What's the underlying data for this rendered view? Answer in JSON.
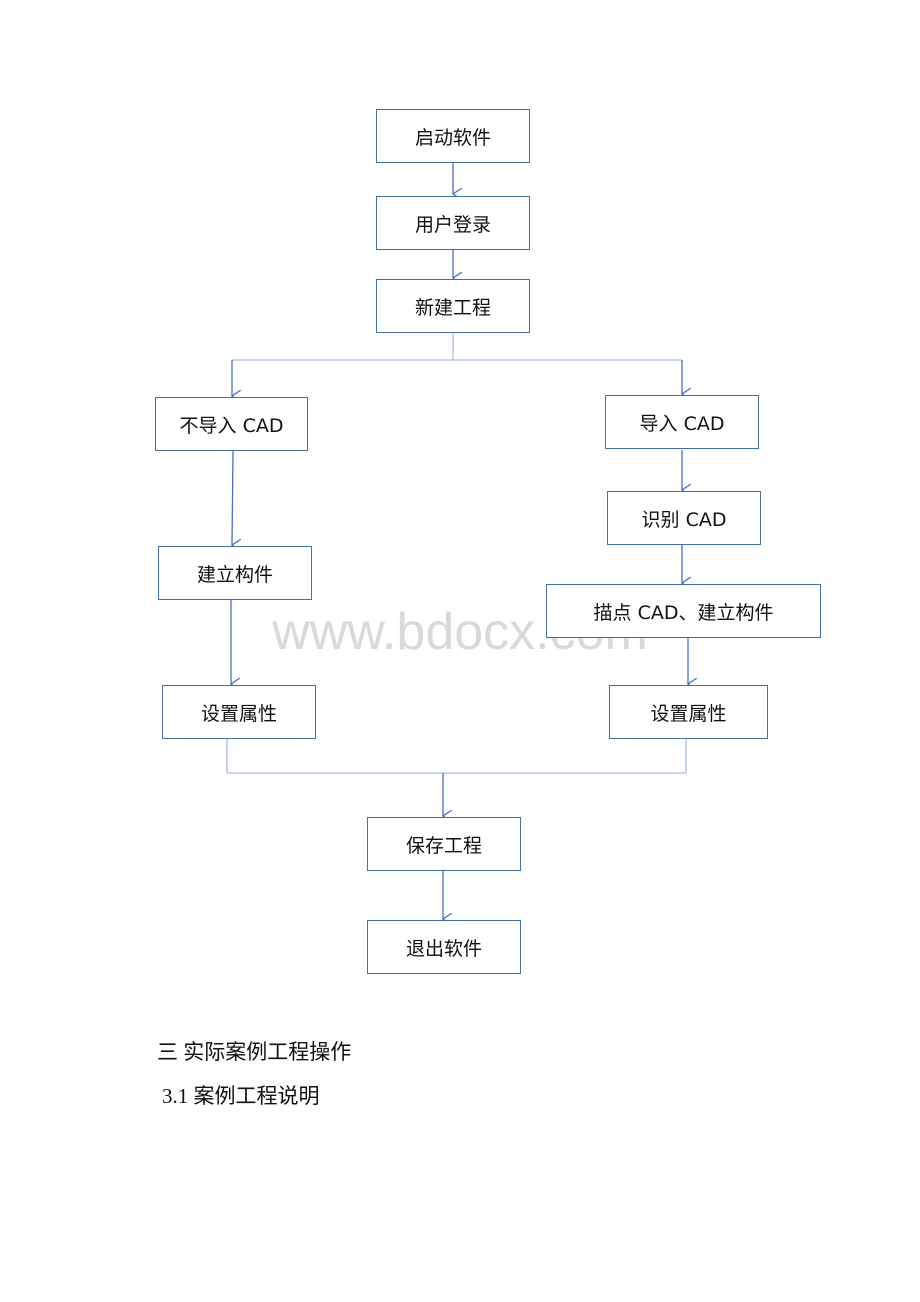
{
  "flowchart": {
    "nodes": [
      "启动软件",
      "用户登录",
      "新建工程",
      "不导入 CAD",
      "导入 CAD",
      "识别 CAD",
      "建立构件",
      "描点 CAD、建立构件",
      "设置属性",
      "设置属性",
      "保存工程",
      "退出软件"
    ],
    "line_color": "#4472c4",
    "border_color": "#41719c"
  },
  "watermark": "www.bdocx.com",
  "section": {
    "heading": "三 实际案例工程操作",
    "subheading": "3.1 案例工程说明"
  }
}
